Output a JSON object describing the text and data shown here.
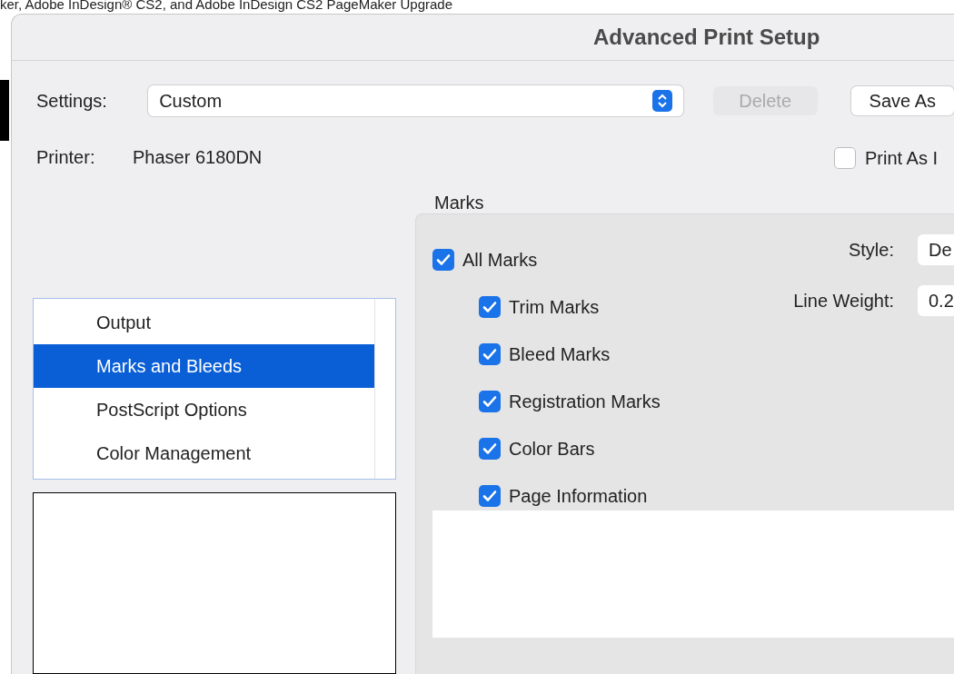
{
  "background_text": "ker, Adobe InDesign® CS2, and Adobe InDesign CS2 PageMaker Upgrade",
  "window": {
    "title": "Advanced Print Setup"
  },
  "settings": {
    "label": "Settings:",
    "value": "Custom",
    "buttons": [
      {
        "label": "Delete",
        "disabled": true
      },
      {
        "label": "Save As",
        "disabled": false
      }
    ]
  },
  "printer": {
    "label": "Printer:",
    "value": "Phaser 6180DN"
  },
  "print_as_image": {
    "label": "Print As I",
    "checked": false
  },
  "categories": [
    {
      "label": "Output",
      "selected": false
    },
    {
      "label": "Marks and Bleeds",
      "selected": true
    },
    {
      "label": "PostScript Options",
      "selected": false
    },
    {
      "label": "Color Management",
      "selected": false
    }
  ],
  "marks": {
    "title": "Marks",
    "all_marks": {
      "label": "All Marks",
      "checked": true
    },
    "items": [
      {
        "label": "Trim Marks",
        "checked": true
      },
      {
        "label": "Bleed Marks",
        "checked": true
      },
      {
        "label": "Registration Marks",
        "checked": true
      },
      {
        "label": "Color Bars",
        "checked": true
      },
      {
        "label": "Page Information",
        "checked": true
      }
    ],
    "style": {
      "label": "Style:",
      "value": "De"
    },
    "line_weight": {
      "label": "Line Weight:",
      "value": "0.2"
    }
  }
}
